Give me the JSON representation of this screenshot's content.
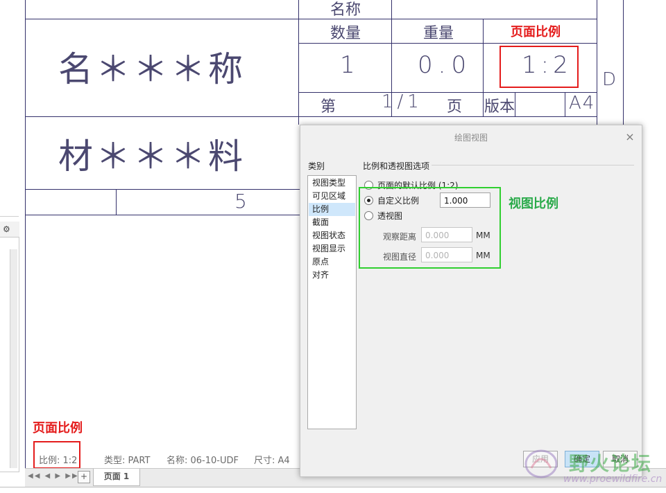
{
  "title_block": {
    "row_name_header": "名称",
    "col_quantity": "数量",
    "col_weight": "重量",
    "col_scale": "页面比例",
    "big_name": "名＊＊＊称",
    "big_material": "材＊＊＊料",
    "quantity_value": "1",
    "weight_value": "0.0",
    "scale_value": "1:2",
    "sheet_prefix": "第",
    "sheet_value": "1/1",
    "sheet_suffix": "页",
    "version_label": "版本",
    "format_value": "A4",
    "zone_letter": "D",
    "row_number": "5"
  },
  "annotations": {
    "top_scale_label": "页面比例",
    "bottom_scale_label": "页面比例",
    "view_scale_label": "视图比例"
  },
  "status_bar": {
    "scale": "比例: 1:2",
    "type": "类型: PART",
    "name": "名称: 06-10-UDF",
    "size": "尺寸: A4"
  },
  "bottom_tabs": {
    "nav_arrows": "◀◀ ◀ ▶ ▶▶",
    "add": "+",
    "page_tab": "页面 1"
  },
  "dialog": {
    "title": "绘图视图",
    "close": "×",
    "category_label": "类别",
    "categories": [
      "视图类型",
      "可见区域",
      "比例",
      "截面",
      "视图状态",
      "视图显示",
      "原点",
      "对齐"
    ],
    "selected_category": "比例",
    "section_title": "比例和透视图选项",
    "options": {
      "default_scale": "页面的默认比例 (1:2)",
      "custom_scale": "自定义比例",
      "perspective": "透视图"
    },
    "custom_scale_value": "1.000",
    "observe_distance_label": "观察距离",
    "observe_distance_placeholder": "0.000",
    "view_diameter_label": "视图直径",
    "view_diameter_placeholder": "0.000",
    "unit": "MM",
    "buttons": {
      "apply": "应用",
      "ok": "确定",
      "cancel": "取消"
    }
  },
  "watermark": {
    "title": "野火论坛",
    "url": "www.proewildfire.cn"
  },
  "colors": {
    "sheet_line": "#33306a",
    "annotation_red": "#e41b1b",
    "annotation_green": "#2fcf2f",
    "selected_item": "#cfe7fb"
  }
}
